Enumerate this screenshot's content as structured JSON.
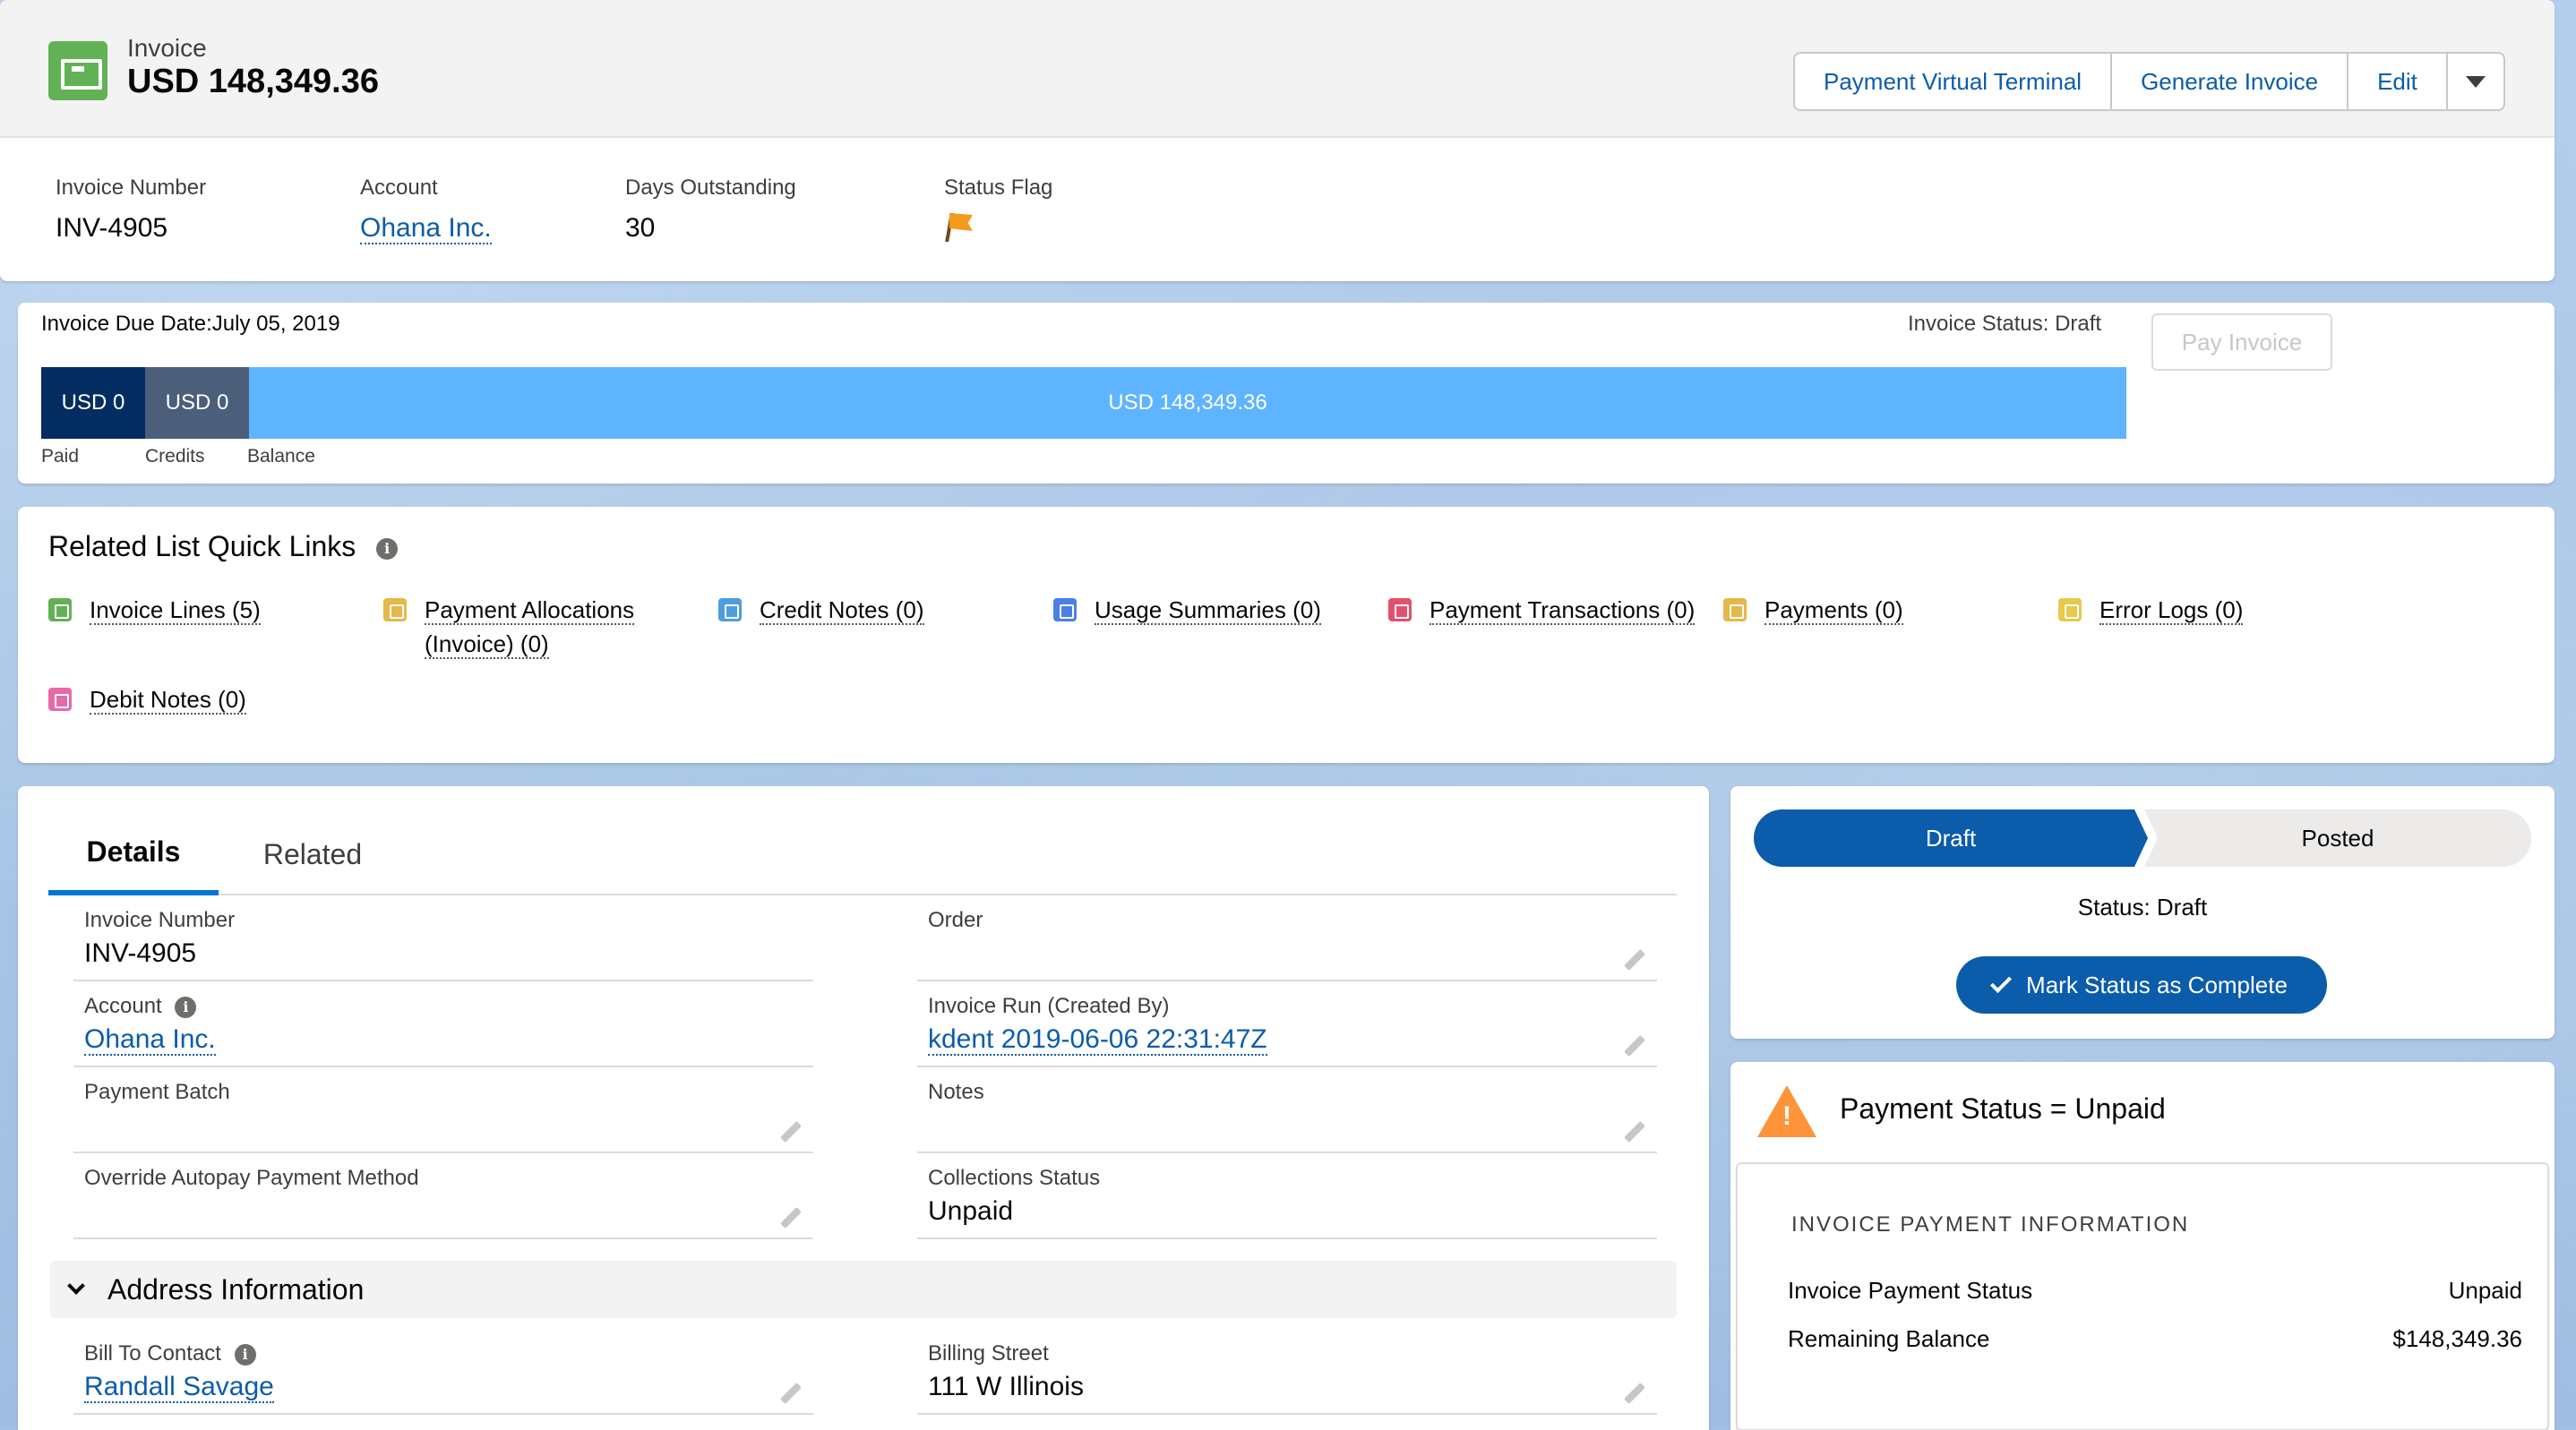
{
  "header": {
    "record_type": "Invoice",
    "title": "USD 148,349.36",
    "actions": {
      "payment_virtual_terminal": "Payment Virtual Terminal",
      "generate_invoice": "Generate Invoice",
      "edit": "Edit"
    },
    "highlights": [
      {
        "label": "Invoice Number",
        "value": "INV-4905"
      },
      {
        "label": "Account",
        "value": "Ohana Inc."
      },
      {
        "label": "Days Outstanding",
        "value": "30"
      },
      {
        "label": "Status Flag",
        "icon": "flag-icon",
        "color": "#f59a1a"
      }
    ]
  },
  "invoice_bar": {
    "due_date": "Invoice Due Date:July 05, 2019",
    "status": "Invoice Status: Draft",
    "pay_button": "Pay Invoice",
    "paid_value": "USD 0",
    "credits_value": "USD 0",
    "balance_value": "USD 148,349.36",
    "paid_label": "Paid",
    "credits_label": "Credits",
    "balance_label": "Balance",
    "colors": {
      "paid": "#032d60",
      "credits": "#4b5e7a",
      "balance": "#5eb4ff"
    }
  },
  "quick_links": {
    "title": "Related List Quick Links",
    "items": [
      {
        "label": "Invoice Lines (5)",
        "icon_color": "#62b255"
      },
      {
        "label": "Payment Allocations (Invoice) (0)",
        "icon_color": "#e6b74a"
      },
      {
        "label": "Credit Notes (0)",
        "icon_color": "#4c9fdc"
      },
      {
        "label": "Usage Summaries (0)",
        "icon_color": "#4c7fe8"
      },
      {
        "label": "Payment Transactions (0)",
        "icon_color": "#e3506d"
      },
      {
        "label": "Payments (0)",
        "icon_color": "#e6b74a"
      },
      {
        "label": "Error Logs (0)",
        "icon_color": "#e8c94a"
      },
      {
        "label": "Debit Notes (0)",
        "icon_color": "#e868a8"
      }
    ]
  },
  "details": {
    "tabs": [
      "Details",
      "Related"
    ],
    "fields": {
      "invoice_number": {
        "label": "Invoice Number",
        "value": "INV-4905"
      },
      "order": {
        "label": "Order",
        "value": ""
      },
      "account": {
        "label": "Account",
        "value": "Ohana Inc."
      },
      "invoice_run": {
        "label": "Invoice Run (Created By)",
        "value": "kdent 2019-06-06 22:31:47Z"
      },
      "payment_batch": {
        "label": "Payment Batch",
        "value": ""
      },
      "notes": {
        "label": "Notes",
        "value": ""
      },
      "override_autopay": {
        "label": "Override Autopay Payment Method",
        "value": ""
      },
      "collections_status": {
        "label": "Collections Status",
        "value": "Unpaid"
      },
      "bill_to_contact": {
        "label": "Bill To Contact",
        "value": "Randall Savage"
      },
      "billing_street": {
        "label": "Billing Street",
        "value": "111 W Illinois"
      }
    },
    "address_section": "Address Information"
  },
  "path": {
    "steps": [
      "Draft",
      "Posted"
    ],
    "status_text": "Status: Draft",
    "mark_button": "Mark Status as Complete",
    "accent": "#0b5cab"
  },
  "payment_status": {
    "title": "Payment Status = Unpaid",
    "section_heading": "INVOICE PAYMENT INFORMATION",
    "rows": [
      {
        "label": "Invoice Payment Status",
        "value": "Unpaid"
      },
      {
        "label": "Remaining Balance",
        "value": "$148,349.36"
      }
    ],
    "warn_color": "#fe9339"
  }
}
